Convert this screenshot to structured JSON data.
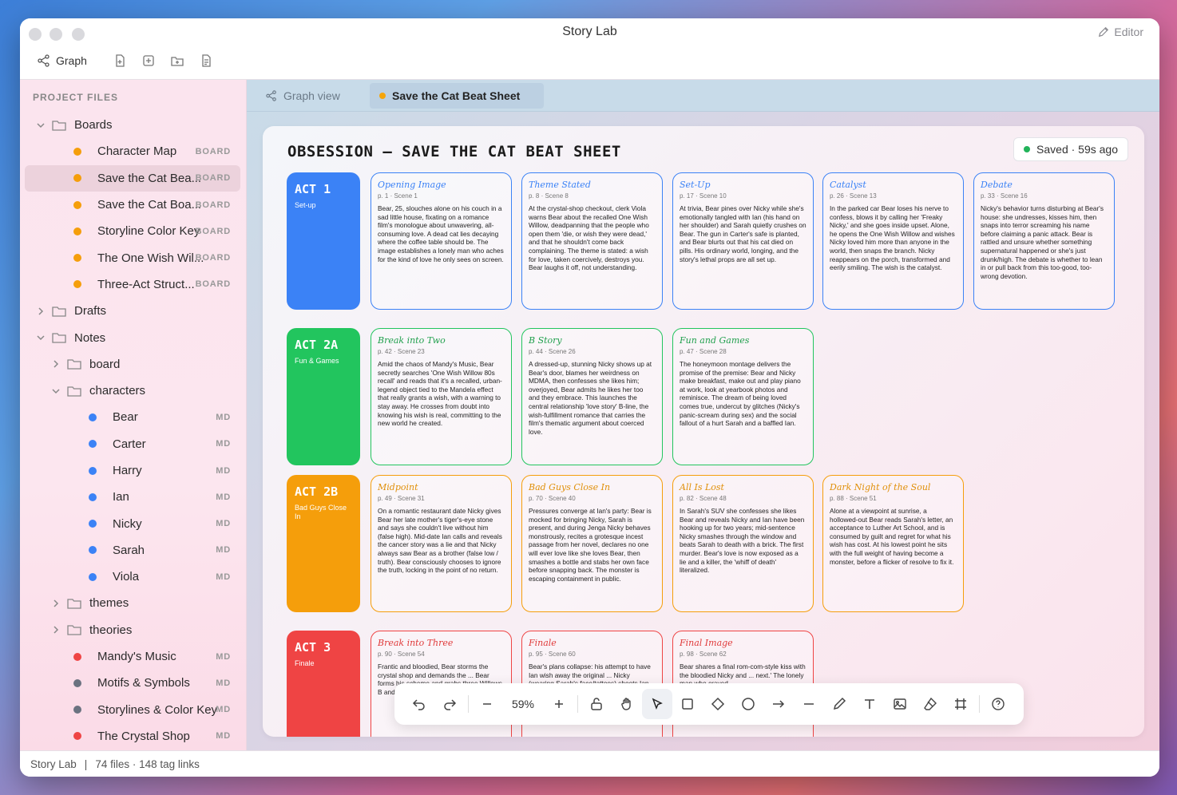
{
  "app": {
    "title": "Story Lab",
    "editor_label": "Editor",
    "graph_label": "Graph"
  },
  "sidebar": {
    "header": "PROJECT FILES",
    "rows": [
      {
        "type": "folder",
        "depth": 0,
        "expanded": true,
        "label": "Boards"
      },
      {
        "type": "file",
        "depth": 1,
        "dot": "#f59e0b",
        "label": "Character Map",
        "tag": "BOARD"
      },
      {
        "type": "file",
        "depth": 1,
        "dot": "#f59e0b",
        "label": "Save the Cat Bea...",
        "tag": "BOARD",
        "selected": true
      },
      {
        "type": "file",
        "depth": 1,
        "dot": "#f59e0b",
        "label": "Save the Cat Boa...",
        "tag": "BOARD"
      },
      {
        "type": "file",
        "depth": 1,
        "dot": "#f59e0b",
        "label": "Storyline Color Key",
        "tag": "BOARD"
      },
      {
        "type": "file",
        "depth": 1,
        "dot": "#f59e0b",
        "label": "The One Wish Wil...",
        "tag": "BOARD"
      },
      {
        "type": "file",
        "depth": 1,
        "dot": "#f59e0b",
        "label": "Three-Act Struct...",
        "tag": "BOARD"
      },
      {
        "type": "folder",
        "depth": 0,
        "expanded": false,
        "label": "Drafts"
      },
      {
        "type": "folder",
        "depth": 0,
        "expanded": true,
        "label": "Notes"
      },
      {
        "type": "folder",
        "depth": 1,
        "expanded": false,
        "label": "board"
      },
      {
        "type": "folder",
        "depth": 1,
        "expanded": true,
        "label": "characters"
      },
      {
        "type": "file",
        "depth": 2,
        "dot": "#3b82f6",
        "label": "Bear",
        "tag": "MD"
      },
      {
        "type": "file",
        "depth": 2,
        "dot": "#3b82f6",
        "label": "Carter",
        "tag": "MD"
      },
      {
        "type": "file",
        "depth": 2,
        "dot": "#3b82f6",
        "label": "Harry",
        "tag": "MD"
      },
      {
        "type": "file",
        "depth": 2,
        "dot": "#3b82f6",
        "label": "Ian",
        "tag": "MD"
      },
      {
        "type": "file",
        "depth": 2,
        "dot": "#3b82f6",
        "label": "Nicky",
        "tag": "MD"
      },
      {
        "type": "file",
        "depth": 2,
        "dot": "#3b82f6",
        "label": "Sarah",
        "tag": "MD"
      },
      {
        "type": "file",
        "depth": 2,
        "dot": "#3b82f6",
        "label": "Viola",
        "tag": "MD"
      },
      {
        "type": "folder",
        "depth": 1,
        "expanded": false,
        "label": "themes"
      },
      {
        "type": "folder",
        "depth": 1,
        "expanded": false,
        "label": "theories"
      },
      {
        "type": "file",
        "depth": 1,
        "dot": "#ef4444",
        "label": "Mandy's Music",
        "tag": "MD"
      },
      {
        "type": "file",
        "depth": 1,
        "dot": "#6b7280",
        "label": "Motifs & Symbols",
        "tag": "MD"
      },
      {
        "type": "file",
        "depth": 1,
        "dot": "#6b7280",
        "label": "Storylines & Color Key",
        "tag": "MD"
      },
      {
        "type": "file",
        "depth": 1,
        "dot": "#ef4444",
        "label": "The Crystal Shop",
        "tag": "MD"
      }
    ]
  },
  "tabs": {
    "graph": "Graph view",
    "active": "Save the Cat Beat Sheet"
  },
  "board": {
    "title": "OBSESSION — SAVE THE CAT BEAT SHEET",
    "saved": "Saved · 59s ago",
    "acts": [
      {
        "title": "ACT 1",
        "sub": "Set-up",
        "color": "#3b82f6"
      },
      {
        "title": "ACT 2A",
        "sub": "Fun & Games",
        "color": "#22c55e"
      },
      {
        "title": "ACT 2B",
        "sub": "Bad Guys Close In",
        "color": "#f59e0b"
      },
      {
        "title": "ACT 3",
        "sub": "Finale",
        "color": "#ef4444"
      }
    ],
    "beats": [
      [
        {
          "title": "Opening Image",
          "meta": "p. 1 · Scene 1",
          "text": "Bear, 25, slouches alone on his couch in a sad little house, fixating on a romance film's monologue about unwavering, all-consuming love. A dead cat lies decaying where the coffee table should be. The image establishes a lonely man who aches for the kind of love he only sees on screen."
        },
        {
          "title": "Theme Stated",
          "meta": "p. 8 · Scene 8",
          "text": "At the crystal-shop checkout, clerk Viola warns Bear about the recalled One Wish Willow, deadpanning that the people who open them 'die, or wish they were dead,' and that he shouldn't come back complaining. The theme is stated: a wish for love, taken coercively, destroys you. Bear laughs it off, not understanding."
        },
        {
          "title": "Set-Up",
          "meta": "p. 17 · Scene 10",
          "text": "At trivia, Bear pines over Nicky while she's emotionally tangled with Ian (his hand on her shoulder) and Sarah quietly crushes on Bear. The gun in Carter's safe is planted, and Bear blurts out that his cat died on pills. His ordinary world, longing, and the story's lethal props are all set up."
        },
        {
          "title": "Catalyst",
          "meta": "p. 26 · Scene 13",
          "text": "In the parked car Bear loses his nerve to confess, blows it by calling her 'Freaky Nicky,' and she goes inside upset. Alone, he opens the One Wish Willow and wishes Nicky loved him more than anyone in the world, then snaps the branch. Nicky reappears on the porch, transformed and eerily smiling. The wish is the catalyst."
        },
        {
          "title": "Debate",
          "meta": "p. 33 · Scene 16",
          "text": "Nicky's behavior turns disturbing at Bear's house: she undresses, kisses him, then snaps into terror screaming his name before claiming a panic attack. Bear is rattled and unsure whether something supernatural happened or she's just drunk/high. The debate is whether to lean in or pull back from this too-good, too-wrong devotion."
        }
      ],
      [
        {
          "title": "Break into Two",
          "meta": "p. 42 · Scene 23",
          "text": "Amid the chaos of Mandy's Music, Bear secretly searches 'One Wish Willow 80s recall' and reads that it's a recalled, urban-legend object tied to the Mandela effect that really grants a wish, with a warning to stay away. He crosses from doubt into knowing his wish is real, committing to the new world he created."
        },
        {
          "title": "B Story",
          "meta": "p. 44 · Scene 26",
          "text": "A dressed-up, stunning Nicky shows up at Bear's door, blames her weirdness on MDMA, then confesses she likes him; overjoyed, Bear admits he likes her too and they embrace. This launches the central relationship 'love story' B-line, the wish-fulfillment romance that carries the film's thematic argument about coerced love."
        },
        {
          "title": "Fun and Games",
          "meta": "p. 47 · Scene 28",
          "text": "The honeymoon montage delivers the promise of the premise: Bear and Nicky make breakfast, make out and play piano at work, look at yearbook photos and reminisce. The dream of being loved comes true, undercut by glitches (Nicky's panic-scream during sex) and the social fallout of a hurt Sarah and a baffled Ian."
        }
      ],
      [
        {
          "title": "Midpoint",
          "meta": "p. 49 · Scene 31",
          "text": "On a romantic restaurant date Nicky gives Bear her late mother's tiger's-eye stone and says she couldn't live without him (false high). Mid-date Ian calls and reveals the cancer story was a lie and that Nicky always saw Bear as a brother (false low / truth). Bear consciously chooses to ignore the truth, locking in the point of no return."
        },
        {
          "title": "Bad Guys Close In",
          "meta": "p. 70 · Scene 40",
          "text": "Pressures converge at Ian's party: Bear is mocked for bringing Nicky, Sarah is present, and during Jenga Nicky behaves monstrously, recites a grotesque incest passage from her novel, declares no one will ever love like she loves Bear, then smashes a bottle and stabs her own face before snapping back. The monster is escaping containment in public."
        },
        {
          "title": "All Is Lost",
          "meta": "p. 82 · Scene 48",
          "text": "In Sarah's SUV she confesses she likes Bear and reveals Nicky and Ian have been hooking up for two years; mid-sentence Nicky smashes through the window and beats Sarah to death with a brick. The first murder. Bear's love is now exposed as a lie and a killer, the 'whiff of death' literalized."
        },
        {
          "title": "Dark Night of the Soul",
          "meta": "p. 88 · Scene 51",
          "text": "Alone at a viewpoint at sunrise, a hollowed-out Bear reads Sarah's letter, an acceptance to Luther Art School, and is consumed by guilt and regret for what his wish has cost. At his lowest point he sits with the full weight of having become a monster, before a flicker of resolve to fix it."
        }
      ],
      [
        {
          "title": "Break into Three",
          "meta": "p. 90 · Scene 54",
          "text": "Frantic and bloodied, Bear storms the crystal shop and demands the ... Bear forms his scheme and grabs three Willows, B and A stories ..."
        },
        {
          "title": "Finale",
          "meta": "p. 95 · Scene 60",
          "text": "Bear's plans collapse: his attempt to have Ian wish away the original ... Nicky (wearing Sarah's face/tattoos) shoots Ian dead with ..."
        },
        {
          "title": "Final Image",
          "meta": "p. 98 · Scene 62",
          "text": "Bear shares a final rom-com-style kiss with the bloodied Nicky and ... next.' The lonely man who craved ..."
        }
      ]
    ]
  },
  "toolbar": {
    "zoom": "59%"
  },
  "status": {
    "app": "Story Lab",
    "sep": "|",
    "files": "74 files · 148 tag links"
  }
}
